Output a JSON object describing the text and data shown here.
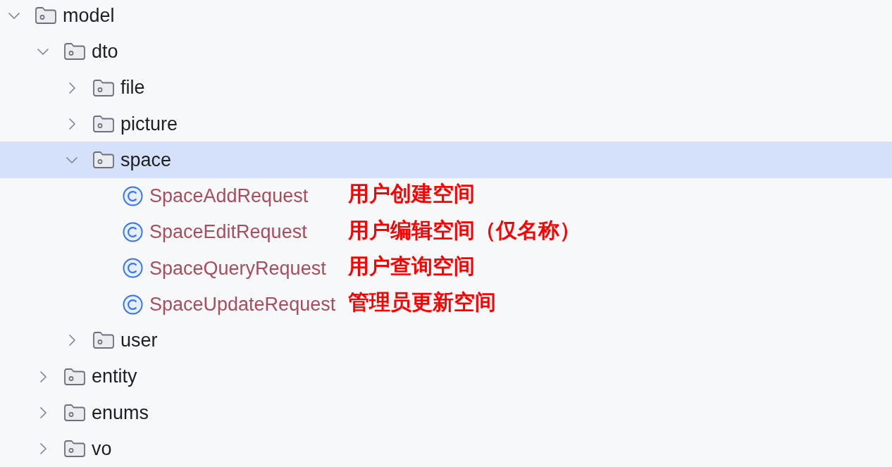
{
  "tree": [
    {
      "label": "model",
      "kind": "folder",
      "expanded": true,
      "selected": false,
      "children": [
        {
          "label": "dto",
          "kind": "folder",
          "expanded": true,
          "selected": false,
          "children": [
            {
              "label": "file",
              "kind": "folder",
              "expanded": false,
              "selected": false
            },
            {
              "label": "picture",
              "kind": "folder",
              "expanded": false,
              "selected": false
            },
            {
              "label": "space",
              "kind": "folder",
              "expanded": true,
              "selected": true,
              "children": [
                {
                  "label": "SpaceAddRequest",
                  "kind": "class",
                  "selected": false,
                  "note": "用户创建空间"
                },
                {
                  "label": "SpaceEditRequest",
                  "kind": "class",
                  "selected": false,
                  "note": "用户编辑空间（仅名称）"
                },
                {
                  "label": "SpaceQueryRequest",
                  "kind": "class",
                  "selected": false,
                  "note": "用户查询空间"
                },
                {
                  "label": "SpaceUpdateRequest",
                  "kind": "class",
                  "selected": false,
                  "note": "管理员更新空间"
                }
              ]
            },
            {
              "label": "user",
              "kind": "folder",
              "expanded": false,
              "selected": false
            }
          ]
        },
        {
          "label": "entity",
          "kind": "folder",
          "expanded": false,
          "selected": false
        },
        {
          "label": "enums",
          "kind": "folder",
          "expanded": false,
          "selected": false
        },
        {
          "label": "vo",
          "kind": "folder",
          "expanded": false,
          "selected": false
        }
      ]
    }
  ]
}
